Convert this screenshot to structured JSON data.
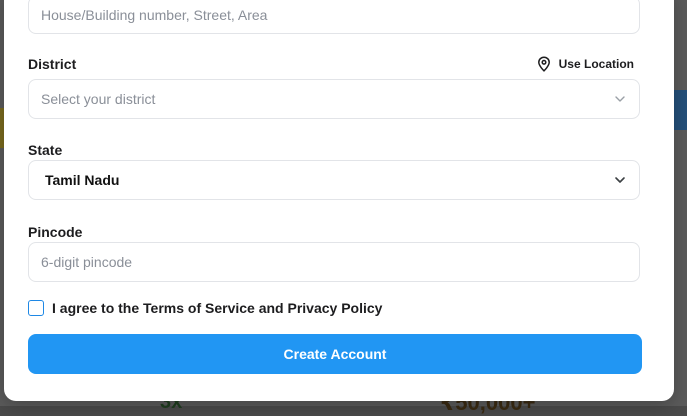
{
  "form": {
    "address_placeholder": "House/Building number, Street, Area",
    "district_label": "District",
    "use_location_label": "Use Location",
    "district_placeholder": "Select your district",
    "state_label": "State",
    "state_value": "Tamil Nadu",
    "pincode_label": "Pincode",
    "pincode_placeholder": "6-digit pincode",
    "terms_label": "I agree to the Terms of Service and Privacy Policy",
    "submit_label": "Create Account"
  },
  "background": {
    "left_text": "3x",
    "right_text": "₹50,000+"
  },
  "colors": {
    "accent": "#2196f3",
    "checkbox_border": "#1e88e5"
  },
  "icons": {
    "location": "map-pin-icon",
    "dropdown": "chevron-down-icon"
  }
}
